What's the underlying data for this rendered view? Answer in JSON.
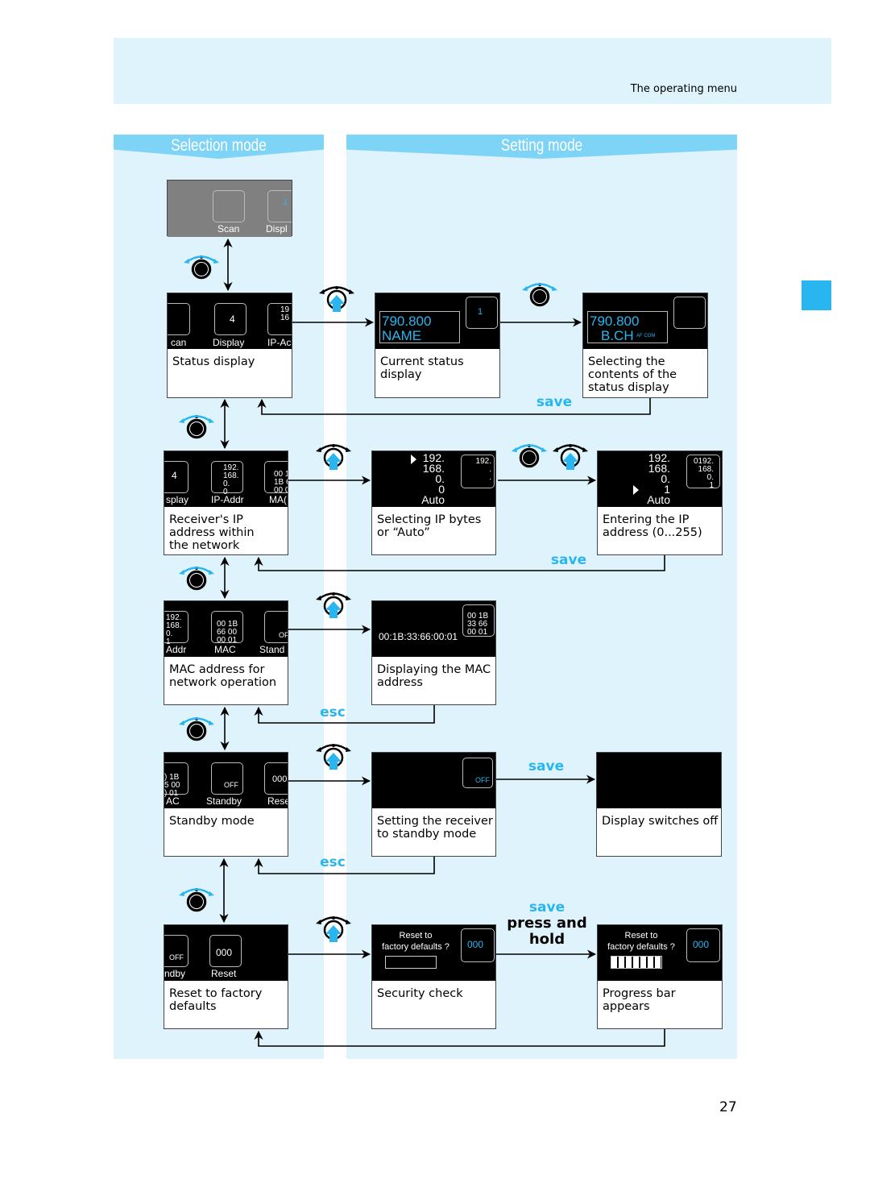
{
  "header": {
    "title": "The operating menu"
  },
  "columns": {
    "selection": "Selection mode",
    "setting": "Setting mode"
  },
  "page_number": "27",
  "colors": {
    "accent": "#29b6f0",
    "band": "#dff3fc",
    "column_header": "#7dd4f7"
  },
  "labels": {
    "save": "save",
    "esc": "esc",
    "press_and_hold": "press and\nhold"
  },
  "boxes": [
    {
      "id": "scan",
      "caption": "",
      "screen": [
        "Scan",
        "Displ",
        "1"
      ]
    },
    {
      "id": "status-display",
      "caption": "Status display",
      "screen": [
        "can",
        "Display",
        "IP-Ac",
        "4",
        "19\n16"
      ]
    },
    {
      "id": "current-status-display",
      "caption": "Current status\ndisplay",
      "screen": [
        "790.800",
        "NAME",
        "1"
      ]
    },
    {
      "id": "selecting-status-contents",
      "caption": "Selecting the\ncontents of the\nstatus display",
      "screen": [
        "790.800",
        "B.CH",
        "AF COM"
      ]
    },
    {
      "id": "receiver-ip",
      "caption": "Receiver's IP\naddress within\nthe network",
      "screen": [
        "splay",
        "IP-Addr",
        "MA(",
        "192.\n168.\n0.\n0",
        "00 1\n1B 6\n00 0",
        "4"
      ]
    },
    {
      "id": "selecting-ip-bytes",
      "caption": "Selecting IP bytes\nor “Auto”",
      "screen": [
        "192.\n168.\n0.\n0\nAuto",
        "192.\n.\n."
      ]
    },
    {
      "id": "entering-ip",
      "caption": "Entering the IP\naddress (0...255)",
      "screen": [
        "192.\n168.\n0.\n1\nAuto",
        "0192.\n168.\n0.\n1"
      ]
    },
    {
      "id": "mac-address",
      "caption": "MAC address for\nnetwork operation",
      "screen": [
        "Addr",
        "MAC",
        "Stand",
        "192.\n168.\n0.\n1",
        "00 1B\n66 00\n00 01",
        "OF"
      ]
    },
    {
      "id": "displaying-mac",
      "caption": "Displaying the MAC\naddress",
      "screen": [
        "00:1B:33:66:00:01",
        "00 1B\n33 66\n00 01"
      ]
    },
    {
      "id": "standby-mode",
      "caption": "Standby mode",
      "screen": [
        "AC",
        "Standby",
        "Rese",
        ") 1B\n5 00\n) 01",
        "OFF",
        "000"
      ]
    },
    {
      "id": "setting-standby",
      "caption": "Setting the receiver\nto standby mode",
      "screen": [
        "OFF"
      ]
    },
    {
      "id": "display-off",
      "caption": "Display switches off",
      "screen": []
    },
    {
      "id": "reset-factory",
      "caption": "Reset to factory\ndefaults",
      "screen": [
        "ndby",
        "Reset",
        "000",
        "OFF"
      ]
    },
    {
      "id": "security-check",
      "caption": "Security check",
      "screen": [
        "Reset to\nfactory defaults ?",
        "000"
      ]
    },
    {
      "id": "progress-bar",
      "caption": "Progress bar\nappears",
      "screen": [
        "Reset to\nfactory defaults ?",
        "000"
      ],
      "progress": 1.0
    }
  ]
}
